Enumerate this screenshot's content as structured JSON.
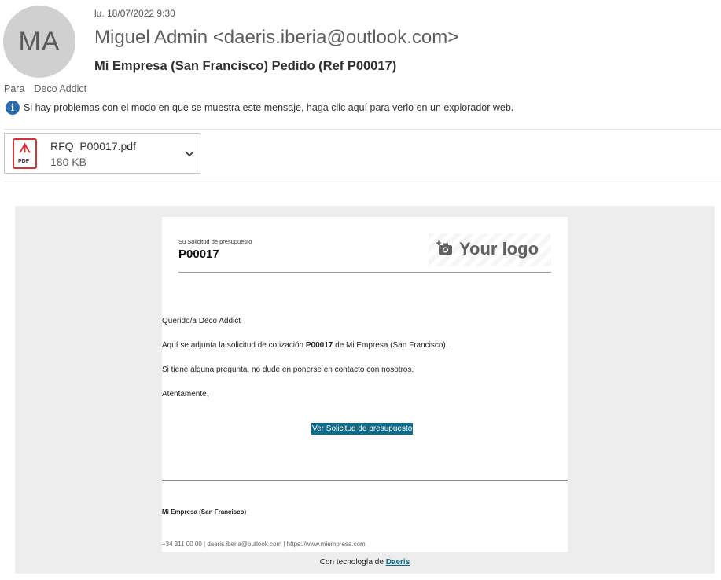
{
  "header": {
    "avatar_initials": "MA",
    "date": "lu. 18/07/2022 9:30",
    "sender": "Miguel Admin <daeris.iberia@outlook.com>",
    "subject": "Mi Empresa (San Francisco) Pedido (Ref P00017)",
    "to_label": "Para",
    "to_name": "Deco Addict",
    "info_message": "Si hay problemas con el modo en que se muestra este mensaje, haga clic aquí para verlo en un explorador web."
  },
  "attachment": {
    "icon": "pdf-icon",
    "icon_text": "PDF",
    "filename": "RFQ_P00017.pdf",
    "size": "180 KB"
  },
  "email_body": {
    "rfq_label": "Su Solicitud de presupuesto",
    "rfq_ref": "P00017",
    "logo_text": "Your logo",
    "greeting": "Querido/a Deco Addict",
    "line1_pre": "Aquí se adjunta la solicitud de cotización ",
    "line1_ref": "P00017",
    "line1_post": " de Mi Empresa (San Francisco).",
    "line2": "Si tiene alguna pregunta, no dude en ponerse en contacto con nosotros.",
    "closing": "Atentamente,",
    "cta_label": "Ver Solicitud de presupuesto",
    "company": "Mi Empresa (San Francisco)",
    "contact": "+34 311 00 00 | daeris.iberia@outlook.com | https://www.miempresa.com",
    "powered_by_pre": "Con tecnología de ",
    "powered_by_link": "Daeris"
  },
  "colors": {
    "accent": "#0c6a8a",
    "pdf_red": "#d13438",
    "info_blue": "#2b6cb0"
  }
}
